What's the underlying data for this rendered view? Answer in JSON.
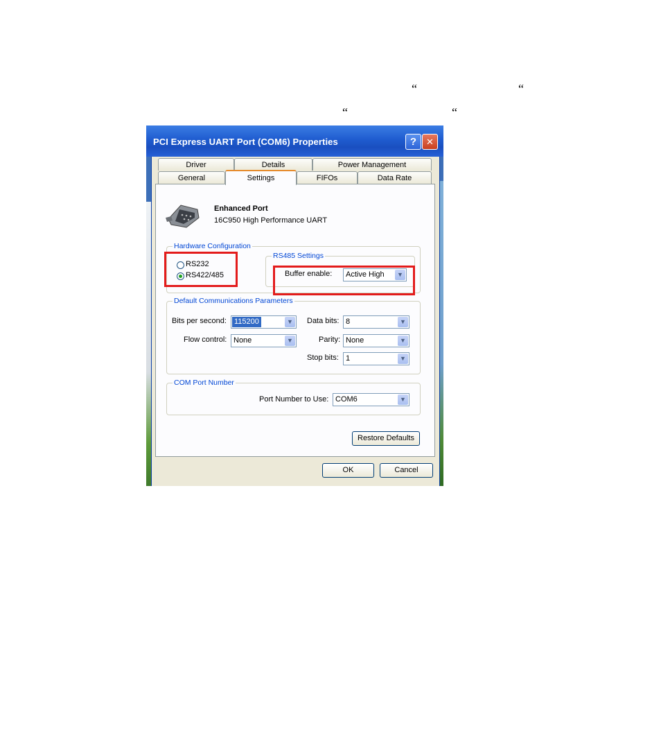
{
  "quotes": [
    "“",
    "“",
    "“",
    "“"
  ],
  "window": {
    "title": "PCI Express UART Port (COM6) Properties",
    "help_label": "?",
    "close_label": "✕"
  },
  "tabs": {
    "row1": [
      "Driver",
      "Details",
      "Power Management"
    ],
    "row2": [
      "General",
      "Settings",
      "FIFOs",
      "Data Rate"
    ],
    "active": "Settings"
  },
  "device": {
    "icon": "serial-port-icon",
    "name": "Enhanced Port",
    "description": "16C950 High Performance UART"
  },
  "hardware_config": {
    "legend": "Hardware Configuration",
    "options": [
      "RS232",
      "RS422/485"
    ],
    "selected": "RS422/485"
  },
  "rs485": {
    "legend": "RS485 Settings",
    "buffer_label": "Buffer enable:",
    "buffer_value": "Active High"
  },
  "comm_params": {
    "legend": "Default Communications Parameters",
    "bits_per_second_label": "Bits per second:",
    "bits_per_second_value": "115200",
    "flow_control_label": "Flow control:",
    "flow_control_value": "None",
    "data_bits_label": "Data bits:",
    "data_bits_value": "8",
    "parity_label": "Parity:",
    "parity_value": "None",
    "stop_bits_label": "Stop bits:",
    "stop_bits_value": "1"
  },
  "com_port": {
    "legend": "COM Port Number",
    "label": "Port Number to Use:",
    "value": "COM6"
  },
  "buttons": {
    "restore": "Restore Defaults",
    "ok": "OK",
    "cancel": "Cancel"
  },
  "colors": {
    "highlight_box": "#e31b1b",
    "titlebar": "#1f5ccf",
    "dialog_bg": "#ece9d8"
  }
}
